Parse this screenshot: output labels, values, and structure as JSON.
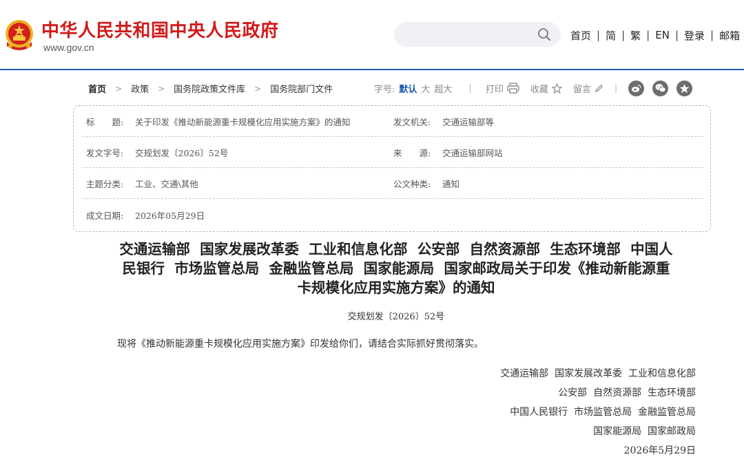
{
  "header": {
    "site_title": "中华人民共和国中央人民政府",
    "site_url": "www.gov.cn",
    "search_placeholder": "",
    "nav": [
      "首页",
      "简",
      "繁",
      "EN",
      "登录",
      "邮箱"
    ]
  },
  "breadcrumb": [
    "首页",
    "政策",
    "国务院政策文件库",
    "国务院部门文件"
  ],
  "tools": {
    "font_size_label": "字号:",
    "font_sizes": [
      "默认",
      "大",
      "超大"
    ],
    "print_label": "打印",
    "favorite_label": "收藏",
    "comment_label": "留言"
  },
  "meta": {
    "title_label": "标　　题:",
    "title_value": "关于印发《推动新能源重卡规模化应用实施方案》的通知",
    "issuer_label": "发文机关:",
    "issuer_value": "交通运输部等",
    "docno_label": "发文字号:",
    "docno_value": "交规划发〔2026〕52号",
    "source_label": "来　　源:",
    "source_value": "交通运输部网站",
    "topic_label": "主题分类:",
    "topic_value": "工业、交通\\其他",
    "type_label": "公文种类:",
    "type_value": "通知",
    "date_label": "成文日期:",
    "date_value": "2026年05月29日"
  },
  "document": {
    "title_line1": "交通运输部  国家发展改革委  工业和信息化部  公安部  自然资源部  生态环境部  中国人",
    "title_line2": "民银行  市场监管总局  金融监管总局  国家能源局  国家邮政局关于印发《推动新能源重",
    "title_line3": "卡规模化应用实施方案》的通知",
    "number": "交规划发〔2026〕52号",
    "paragraph": "现将《推动新能源重卡规模化应用实施方案》印发给你们，请结合实际抓好贯彻落实。",
    "signatories": [
      "交通运输部  国家发展改革委  工业和信息化部",
      "公安部  自然资源部  生态环境部",
      "中国人民银行  市场监管总局  金融监管总局",
      "国家能源局  国家邮政局"
    ],
    "sign_date": "2026年5月29日"
  },
  "colors": {
    "brand_red": "#d11a1a",
    "header_rule": "#1a5aa8",
    "active_font": "#1a5aa8"
  }
}
